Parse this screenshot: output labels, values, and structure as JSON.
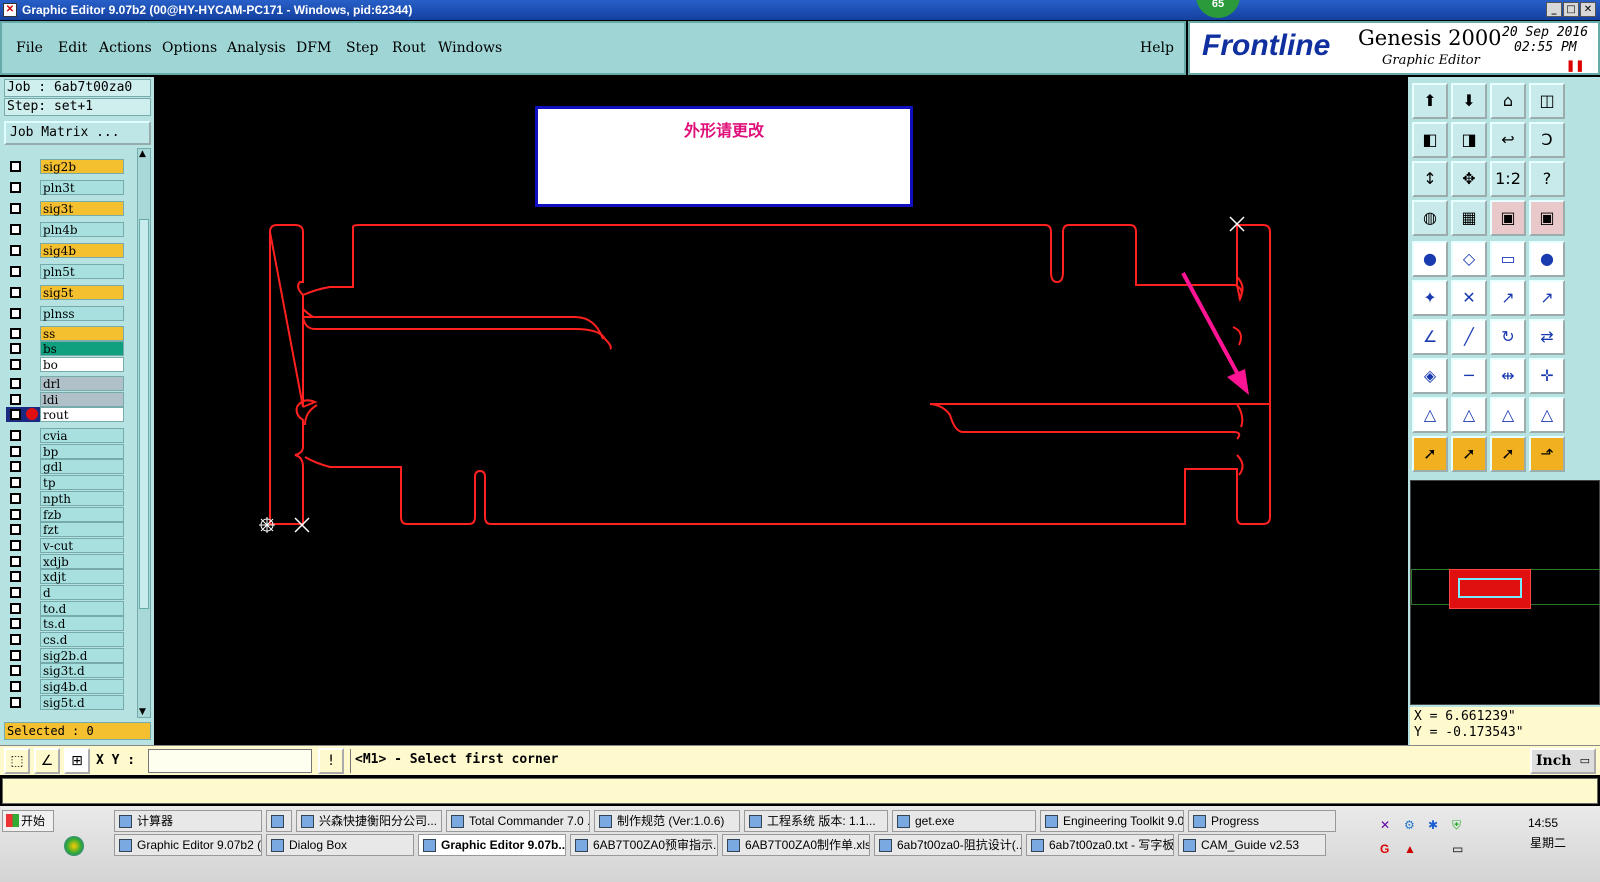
{
  "window": {
    "title": "Graphic Editor 9.07b2 (00@HY-HYCAM-PC171 - Windows, pid:62344)",
    "badge": "65"
  },
  "menu": {
    "items": [
      "File",
      "Edit",
      "Actions",
      "Options",
      "Analysis",
      "DFM",
      "Step",
      "Rout",
      "Windows"
    ],
    "help": "Help"
  },
  "logo": {
    "brand": "Frontline",
    "product": "Genesis 2000",
    "subtitle": "Graphic Editor",
    "date": "20 Sep 2016",
    "time": "02:55 PM"
  },
  "job": {
    "job_line": "Job : 6ab7t00za0",
    "step_line": "Step: set+1",
    "matrix_button": "Job Matrix ..."
  },
  "layers": [
    {
      "name": "sig2b",
      "color": "#f5c030"
    },
    {
      "name": "pln3t",
      "color": "#a8e0e0"
    },
    {
      "name": "sig3t",
      "color": "#f5c030"
    },
    {
      "name": "pln4b",
      "color": "#a8e0e0"
    },
    {
      "name": "sig4b",
      "color": "#f5c030"
    },
    {
      "name": "pln5t",
      "color": "#a8e0e0"
    },
    {
      "name": "sig5t",
      "color": "#f5c030"
    },
    {
      "name": "plnss",
      "color": "#a8e0e0"
    },
    {
      "name": "ss",
      "color": "#f5c030"
    },
    {
      "name": "bs",
      "color": "#10a080"
    },
    {
      "name": "bo",
      "color": "#ffffff"
    },
    {
      "name": "drl",
      "color": "#b0c0c8"
    },
    {
      "name": "ldi",
      "color": "#b0c0c8"
    },
    {
      "name": "rout",
      "color": "#ffffff"
    },
    {
      "name": "cvia",
      "color": "#a8e0e0"
    },
    {
      "name": "bp",
      "color": "#a8e0e0"
    },
    {
      "name": "gdl",
      "color": "#a8e0e0"
    },
    {
      "name": "tp",
      "color": "#a8e0e0"
    },
    {
      "name": "npth",
      "color": "#a8e0e0"
    },
    {
      "name": "fzb",
      "color": "#a8e0e0"
    },
    {
      "name": "fzt",
      "color": "#a8e0e0"
    },
    {
      "name": "v-cut",
      "color": "#a8e0e0"
    },
    {
      "name": "xdjb",
      "color": "#a8e0e0"
    },
    {
      "name": "xdjt",
      "color": "#a8e0e0"
    },
    {
      "name": "d",
      "color": "#a8e0e0"
    },
    {
      "name": "to.d",
      "color": "#a8e0e0"
    },
    {
      "name": "ts.d",
      "color": "#a8e0e0"
    },
    {
      "name": "cs.d",
      "color": "#a8e0e0"
    },
    {
      "name": "sig2b.d",
      "color": "#a8e0e0"
    },
    {
      "name": "sig3t.d",
      "color": "#a8e0e0"
    },
    {
      "name": "sig4b.d",
      "color": "#a8e0e0"
    },
    {
      "name": "sig5t.d",
      "color": "#a8e0e0"
    }
  ],
  "selected": "Selected : 0",
  "canvas": {
    "note": "外形请更改",
    "outline_color": "#ff2020",
    "arrow_color": "#ff1493"
  },
  "coords": {
    "x": "X =  6.661239\"",
    "y": "Y = -0.173543\""
  },
  "command": {
    "xy_label": "X Y :",
    "xy_value": "",
    "prompt": "<M1> - Select first corner",
    "unit": "Inch"
  },
  "taskbar": {
    "start": "开始",
    "row1": [
      "计算器",
      "",
      "兴森快捷衡阳分公司...",
      "Total Commander 7.0 ...",
      "制作规范 (Ver:1.0.6)",
      "工程系统  版本: 1.1...",
      "get.exe",
      "Engineering Toolkit 9.0...",
      "Progress"
    ],
    "row2": [
      "Graphic Editor 9.07b2 (...",
      "Dialog Box",
      "Graphic Editor 9.07b...",
      "6AB7T00ZA0预审指示....",
      "6AB7T00ZA0制作单.xls...",
      "6ab7t00za0-阻抗设计(...",
      "6ab7t00za0.txt - 写字板",
      "CAM_Guide v2.53"
    ],
    "clock": "14:55",
    "weekday": "星期二"
  }
}
